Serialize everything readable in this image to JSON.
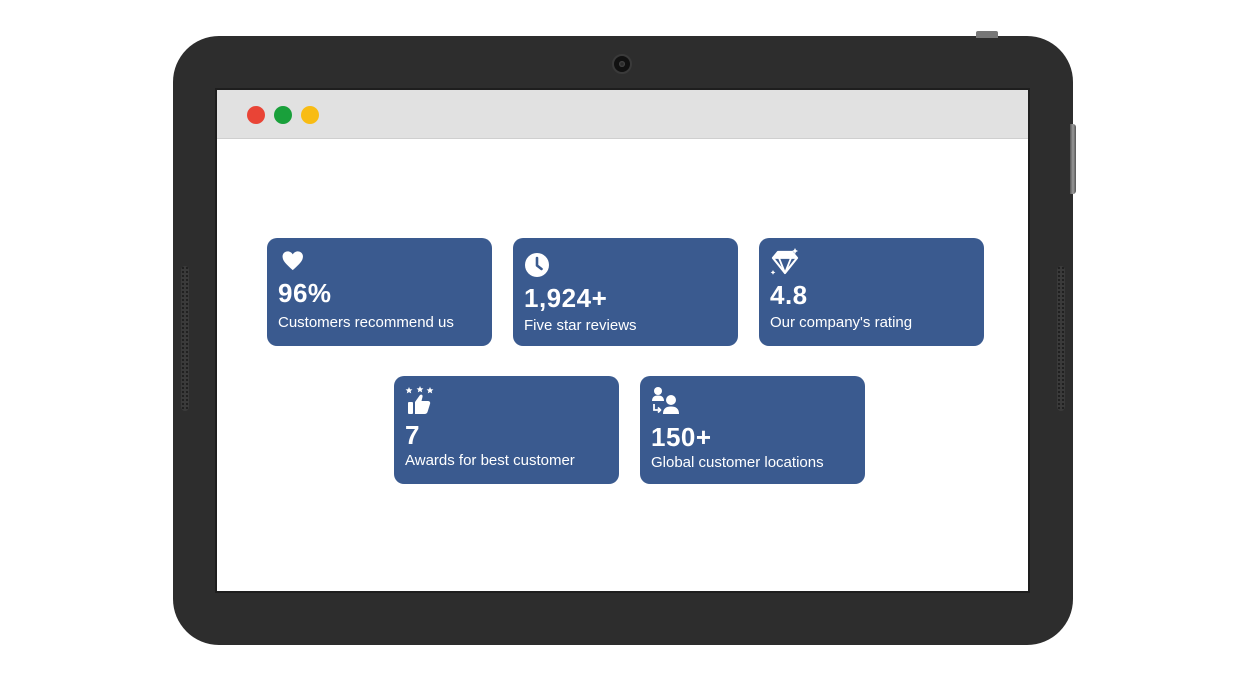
{
  "colors": {
    "card_background": "#3a5a8f",
    "window_red": "#e94436",
    "window_green": "#19a03b",
    "window_yellow": "#f8bc14"
  },
  "stats": [
    {
      "icon": "heart-icon",
      "value": "96%",
      "label": "Customers recommend us"
    },
    {
      "icon": "clock-icon",
      "value": "1,924+",
      "label": "Five star reviews"
    },
    {
      "icon": "diamond-icon",
      "value": "4.8",
      "label": "Our company's rating"
    },
    {
      "icon": "thumbs-up-stars-icon",
      "value": "7",
      "label": "Awards for best customer"
    },
    {
      "icon": "users-exchange-icon",
      "value": "150+",
      "label": "Global customer locations"
    }
  ]
}
